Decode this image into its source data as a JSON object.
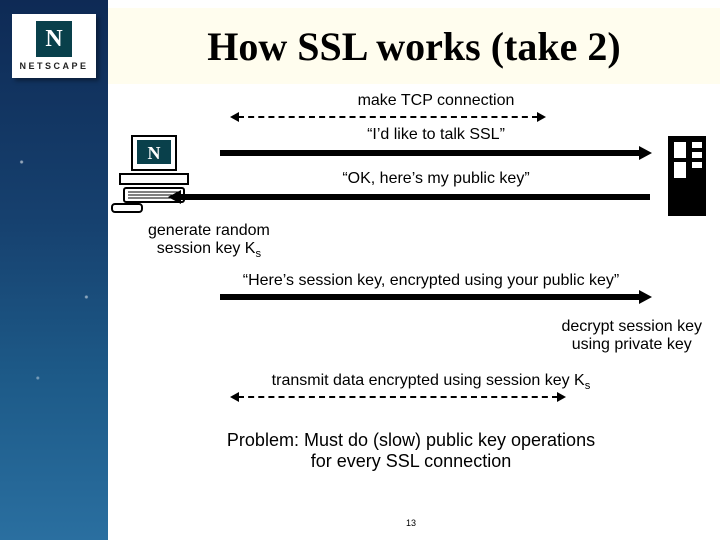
{
  "logo": {
    "mark": "N",
    "name": "NETSCAPE"
  },
  "title": "How SSL works (take 2)",
  "steps": {
    "tcp": "make TCP connection",
    "client_hello": "“I’d like to talk SSL”",
    "server_reply": "“OK, here’s my public key”",
    "gen_key_line1": "generate random",
    "gen_key_line2": "session key K",
    "gen_key_sub": "s",
    "send_key": "“Here’s session key, encrypted using your public key”",
    "decrypt_line1": "decrypt session key",
    "decrypt_line2": "using private key",
    "transmit": "transmit data encrypted using session key K",
    "transmit_sub": "s",
    "problem_line1": "Problem: Must do (slow) public key operations",
    "problem_line2": "for every SSL connection"
  },
  "page": "13"
}
